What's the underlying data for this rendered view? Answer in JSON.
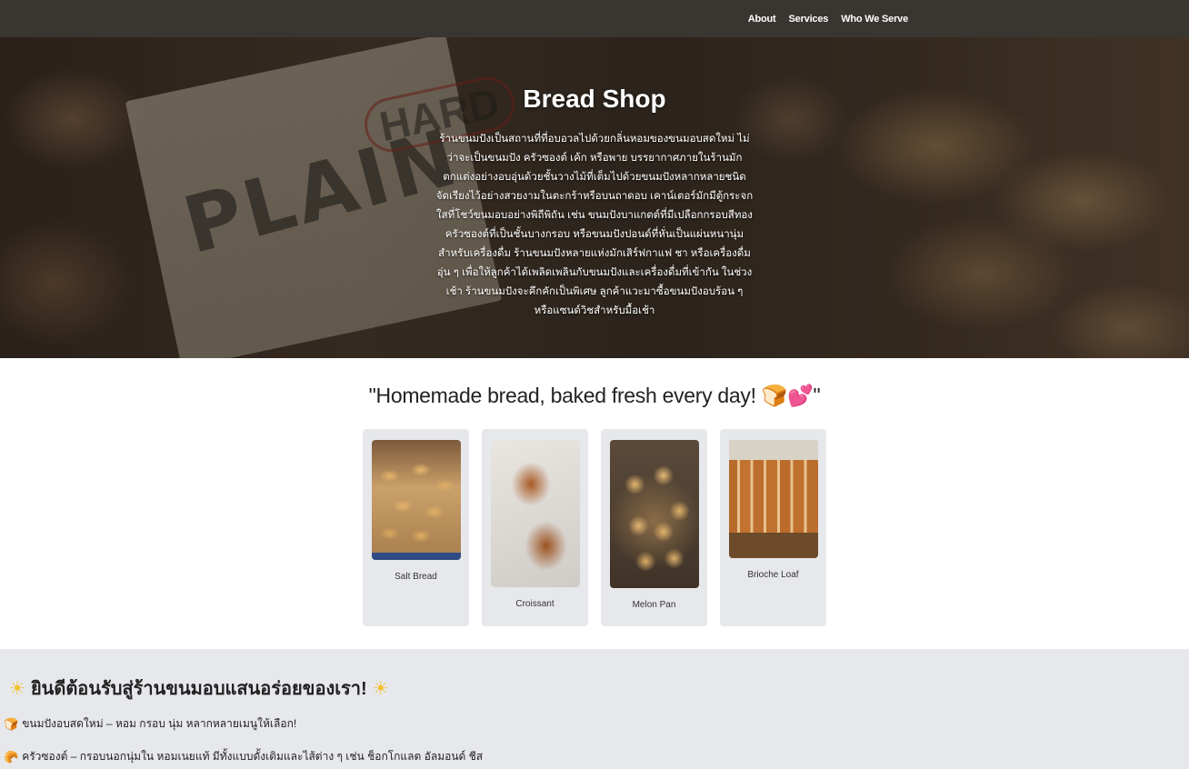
{
  "nav": {
    "links": [
      "About",
      "Services",
      "Who We Serve"
    ]
  },
  "hero": {
    "title": "Bread Shop",
    "description": "ร้านขนมปังเป็นสถานที่ที่อบอวลไปด้วยกลิ่นหอมของขนมอบสดใหม่ ไม่ว่าจะเป็นขนมปัง ครัวซองต์ เค้ก หรือพาย บรรยากาศภายในร้านมักตกแต่งอย่างอบอุ่นด้วยชั้นวางไม้ที่เต็มไปด้วยขนมปังหลากหลายชนิด จัดเรียงไว้อย่างสวยงามในตะกร้าหรือบนถาดอบ เคาน์เตอร์มักมีตู้กระจกใสที่โชว์ขนมอบอย่างพิถีพิถัน เช่น ขนมปังบาแกตต์ที่มีเปลือกกรอบสีทอง ครัวซองต์ที่เป็นชั้นบางกรอบ หรือขนมปังปอนด์ที่หั่นเป็นแผ่นหนานุ่ม สำหรับเครื่องดื่ม ร้านขนมปังหลายแห่งมักเสิร์ฟกาแฟ ชา หรือเครื่องดื่มอุ่น ๆ เพื่อให้ลูกค้าได้เพลิดเพลินกับขนมปังและเครื่องดื่มที่เข้ากัน ในช่วงเช้า ร้านขนมปังจะคึกคักเป็นพิเศษ ลูกค้าแวะมาซื้อขนมปังอบร้อน ๆ หรือแซนด์วิชสำหรับมื้อเช้า",
    "sign_text": "PLAIN",
    "sign_tag": "HARD"
  },
  "tagline": "\"Homemade bread, baked fresh every day! 🍞💕\"",
  "products": [
    {
      "name": "Salt Bread"
    },
    {
      "name": "Croissant"
    },
    {
      "name": "Melon Pan"
    },
    {
      "name": "Brioche Loaf"
    }
  ],
  "welcome": {
    "title": "ยินดีต้อนรับสู่ร้านขนมอบแสนอร่อยของเรา!",
    "icon": "sun-icon",
    "lines": [
      {
        "icon": "🍞",
        "text": "ขนมปังอบสดใหม่ – หอม กรอบ นุ่ม หลากหลายเมนูให้เลือก!"
      },
      {
        "icon": "🥐",
        "text": "ครัวซองต์ – กรอบนอกนุ่มใน หอมเนยแท้ มีทั้งแบบดั้งเดิมและไส้ต่าง ๆ เช่น ช็อกโกแลต อัลมอนด์ ชีส"
      }
    ]
  },
  "colors": {
    "topbar": "#393631",
    "card_bg": "#e7e8ec",
    "sun": "#f2c12e"
  }
}
